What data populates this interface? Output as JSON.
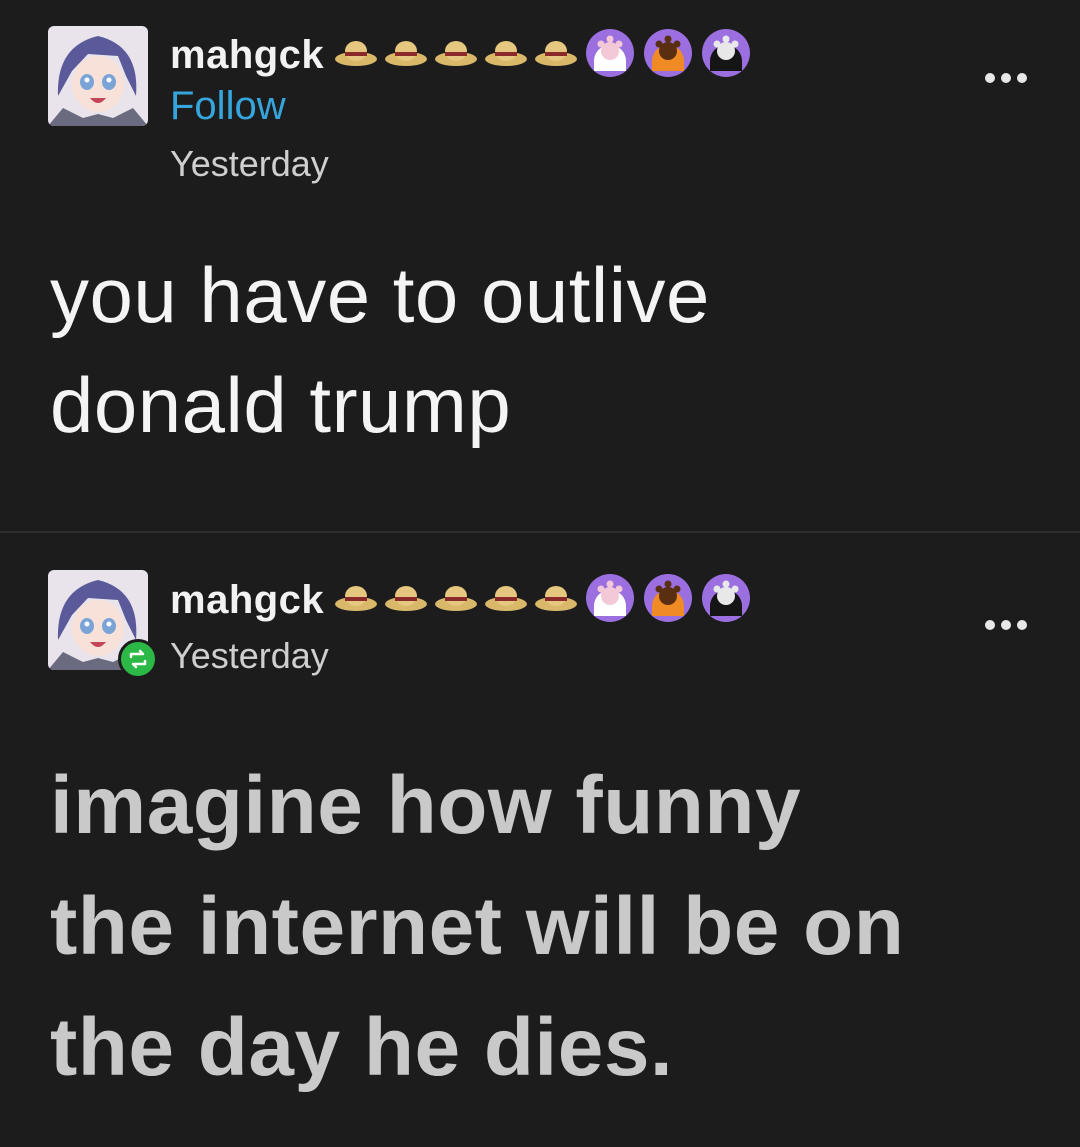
{
  "posts": [
    {
      "username": "mahgck",
      "follow_label": "Follow",
      "timestamp": "Yesterday",
      "text_lines": [
        "you have to outlive",
        "donald trump"
      ],
      "badges": [
        "straw-hat",
        "straw-hat",
        "straw-hat",
        "straw-hat",
        "straw-hat",
        "paw-white",
        "paw-orange",
        "paw-black"
      ]
    },
    {
      "username": "mahgck",
      "timestamp": "Yesterday",
      "reblog_icon": "reblog-icon",
      "text_lines": [
        "imagine how funny",
        "the internet will be on",
        "the day he dies."
      ],
      "badges": [
        "straw-hat",
        "straw-hat",
        "straw-hat",
        "straw-hat",
        "straw-hat",
        "paw-white",
        "paw-orange",
        "paw-black"
      ]
    }
  ],
  "colors": {
    "background": "#1c1c1d",
    "follow": "#36a5dc",
    "reblog": "#2cb847",
    "badge_ring": "#9b6fe0"
  }
}
